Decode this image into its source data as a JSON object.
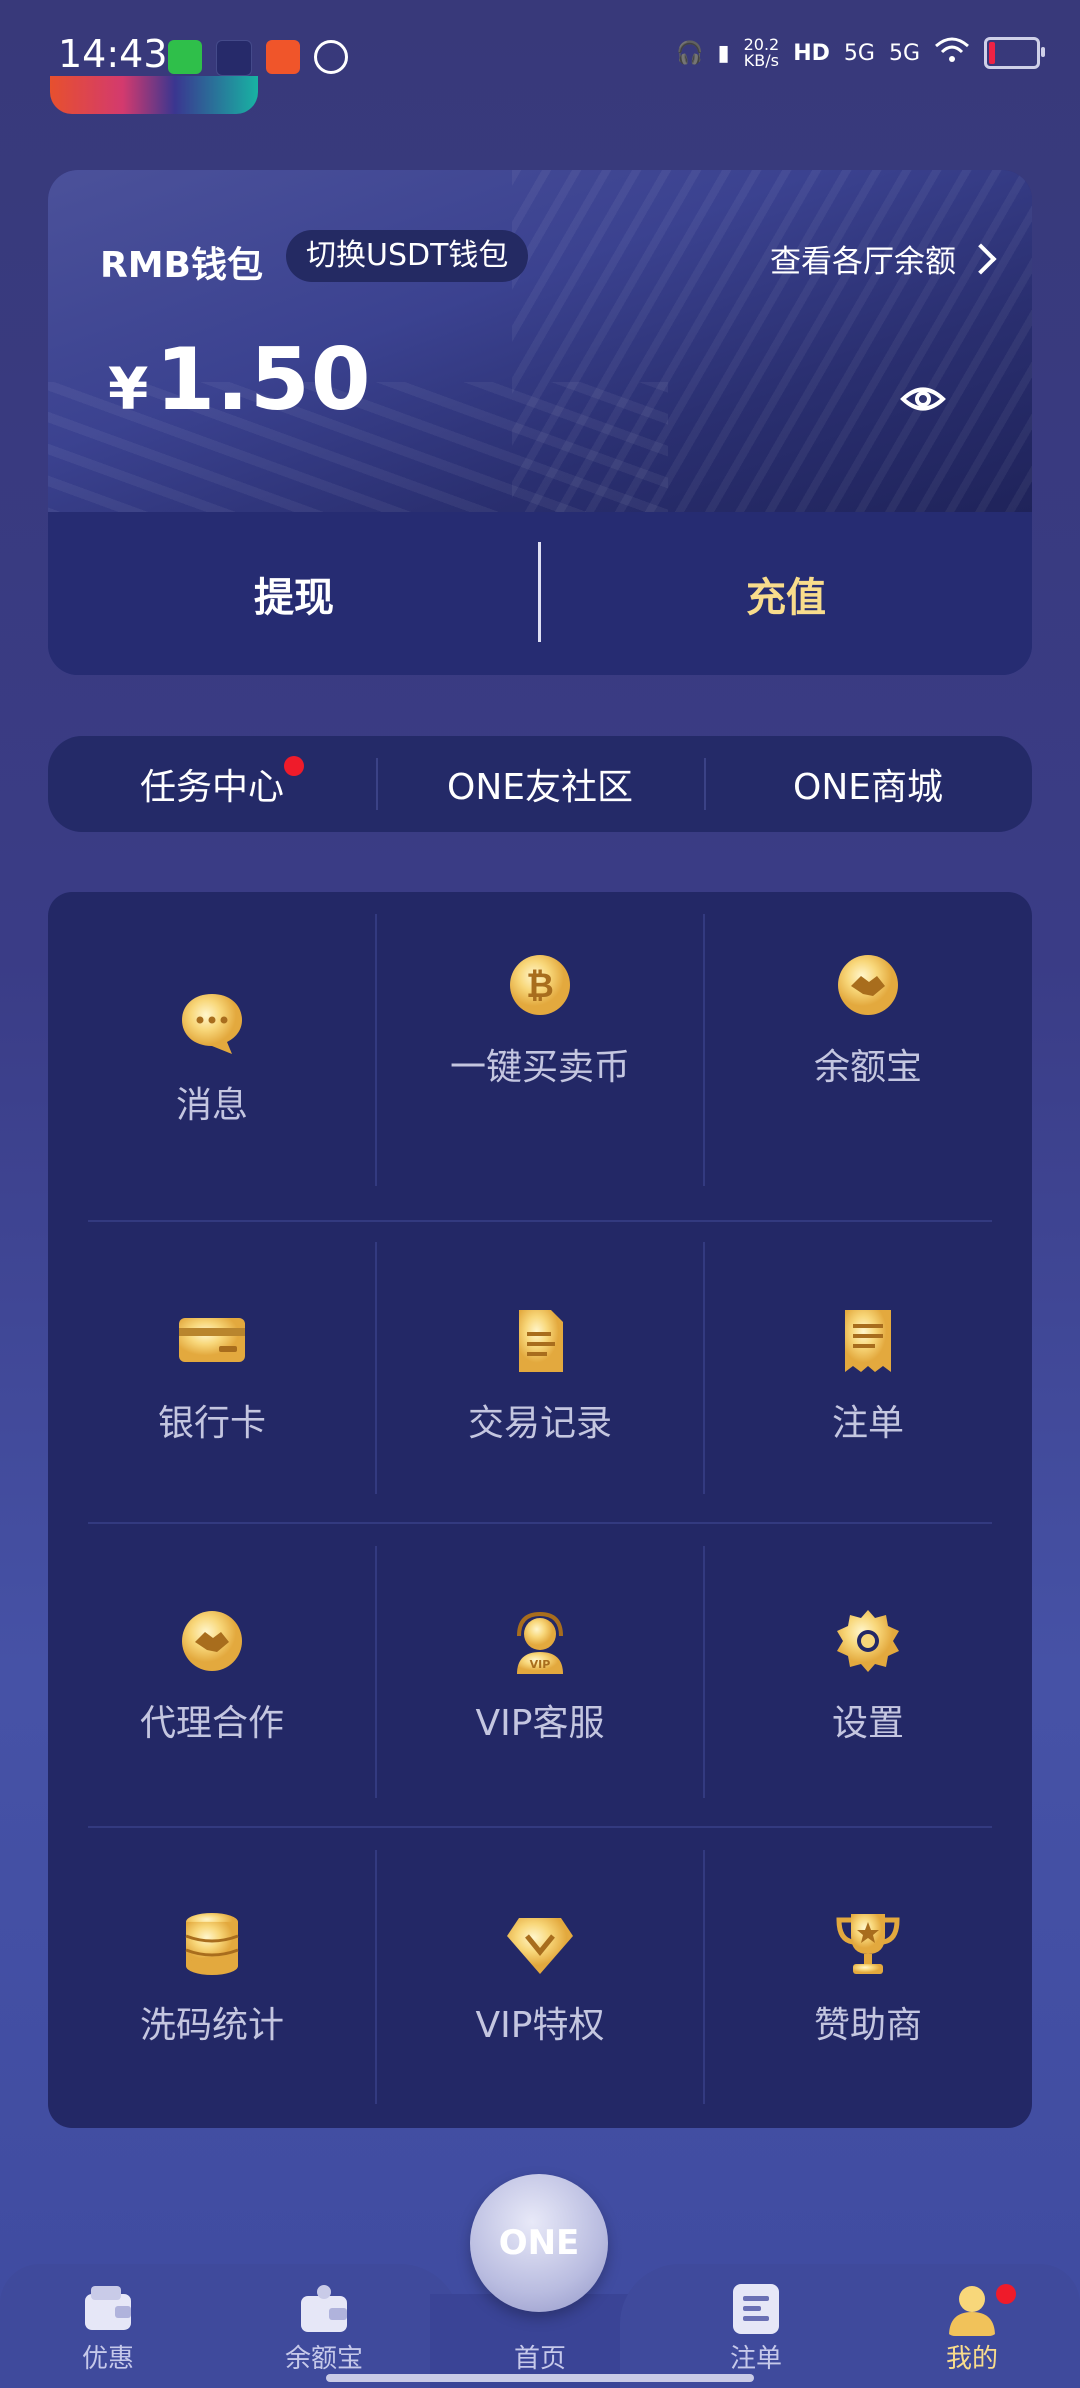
{
  "status_bar": {
    "time": "14:43",
    "net_speed": "20.2\nKB/s",
    "network": "5G"
  },
  "wallet": {
    "title": "RMB钱包",
    "switch_label": "切换USDT钱包",
    "balances_link": "查看各厅余额",
    "currency": "¥",
    "amount": "1.50",
    "withdraw_label": "提现",
    "deposit_label": "充值",
    "accent": "#f8dc8c"
  },
  "quick_links": [
    {
      "label": "任务中心",
      "has_dot": true
    },
    {
      "label": "ONE友社区"
    },
    {
      "label": "ONE商城"
    }
  ],
  "grid": [
    {
      "label": "消息",
      "icon": "chat-bubble-icon"
    },
    {
      "label": "一键买卖币",
      "icon": "bitcoin-icon"
    },
    {
      "label": "余额宝",
      "icon": "handshake-icon"
    },
    {
      "label": "银行卡",
      "icon": "bank-card-icon"
    },
    {
      "label": "交易记录",
      "icon": "document-icon"
    },
    {
      "label": "注单",
      "icon": "receipt-icon"
    },
    {
      "label": "代理合作",
      "icon": "handshake-icon"
    },
    {
      "label": "VIP客服",
      "icon": "vip-support-icon"
    },
    {
      "label": "设置",
      "icon": "gear-icon"
    },
    {
      "label": "洗码统计",
      "icon": "coin-stack-icon"
    },
    {
      "label": "VIP特权",
      "icon": "diamond-icon"
    },
    {
      "label": "赞助商",
      "icon": "trophy-icon"
    }
  ],
  "bottom_nav": {
    "items": [
      {
        "label": "优惠",
        "icon": "wallet-icon"
      },
      {
        "label": "余额宝",
        "icon": "purse-icon"
      },
      {
        "label": "首页",
        "icon": "home-logo-icon"
      },
      {
        "label": "注单",
        "icon": "list-icon"
      },
      {
        "label": "我的",
        "icon": "user-icon",
        "active": true
      }
    ],
    "center_logo": "ONE"
  }
}
